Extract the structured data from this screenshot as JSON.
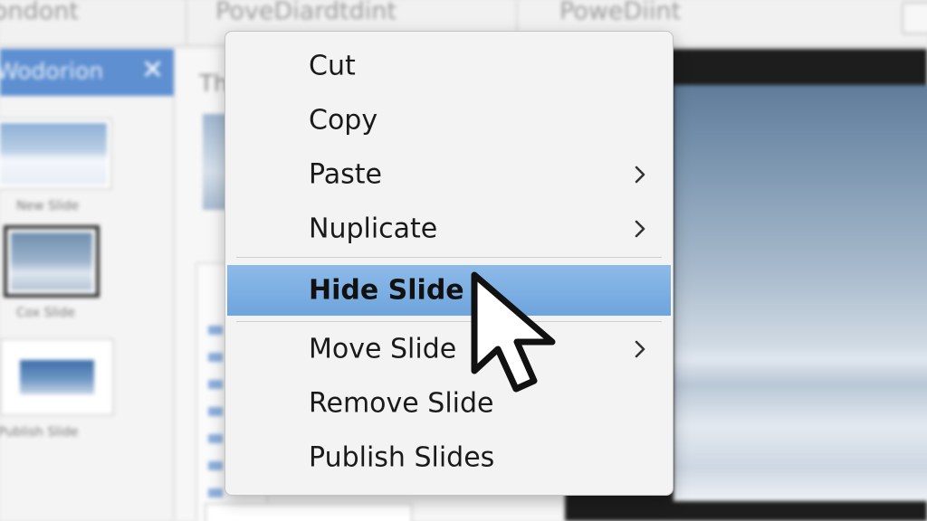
{
  "window": {
    "tabs": [
      "ondont",
      "PoveDiardtdint",
      "PoweDiint"
    ]
  },
  "left_pane": {
    "title": "Wodorion",
    "close_glyph": "✕",
    "thumbnails": [
      {
        "label": "New Slide"
      },
      {
        "label": "Cox Slide"
      },
      {
        "label": "Publish Slide"
      }
    ]
  },
  "mid_pane": {
    "heading": "Th"
  },
  "context_menu": {
    "items": [
      {
        "label": "Cut",
        "submenu": false,
        "highlighted": false
      },
      {
        "label": "Copy",
        "submenu": false,
        "highlighted": false
      },
      {
        "label": "Paste",
        "submenu": true,
        "highlighted": false
      },
      {
        "label": "Nuplicate",
        "submenu": true,
        "highlighted": false
      },
      {
        "label": "Hide Slide",
        "submenu": false,
        "highlighted": true
      },
      {
        "label": "Move Slide",
        "submenu": true,
        "highlighted": false
      },
      {
        "label": "Remove Slide",
        "submenu": false,
        "highlighted": false
      },
      {
        "label": "Publish Slides",
        "submenu": false,
        "highlighted": false
      }
    ]
  },
  "colors": {
    "highlight": "#7aaee2",
    "pane_header": "#5d8fd1",
    "menu_bg": "#f3f3f3"
  },
  "icons": {
    "submenu": "chevron-right-icon",
    "pointer": "mouse-pointer-icon",
    "close": "close-icon"
  }
}
